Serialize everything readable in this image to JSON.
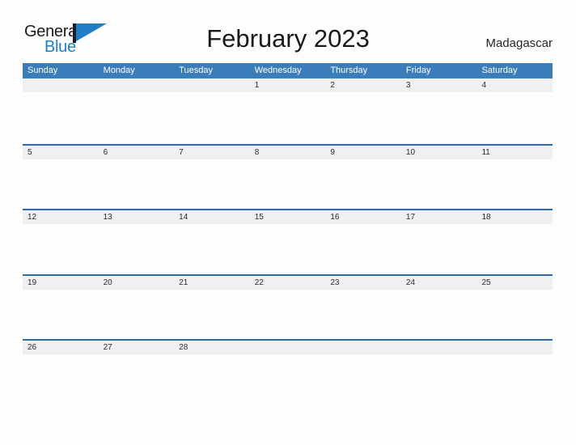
{
  "brand": {
    "word_one": "General",
    "word_two": "Blue",
    "flag_icon": "blue-flag-icon",
    "accent_color": "#1f7ec4",
    "dark_color": "#1b1b1b"
  },
  "header": {
    "title": "February 2023",
    "country": "Madagascar"
  },
  "calendar": {
    "header_bg": "#3b7cbb",
    "row_divider": "#2f6ca6",
    "day_band_bg": "#f0f0f0",
    "weekdays": [
      "Sunday",
      "Monday",
      "Tuesday",
      "Wednesday",
      "Thursday",
      "Friday",
      "Saturday"
    ],
    "weeks": [
      [
        "",
        "",
        "",
        "1",
        "2",
        "3",
        "4"
      ],
      [
        "5",
        "6",
        "7",
        "8",
        "9",
        "10",
        "11"
      ],
      [
        "12",
        "13",
        "14",
        "15",
        "16",
        "17",
        "18"
      ],
      [
        "19",
        "20",
        "21",
        "22",
        "23",
        "24",
        "25"
      ],
      [
        "26",
        "27",
        "28",
        "",
        "",
        "",
        ""
      ]
    ]
  }
}
